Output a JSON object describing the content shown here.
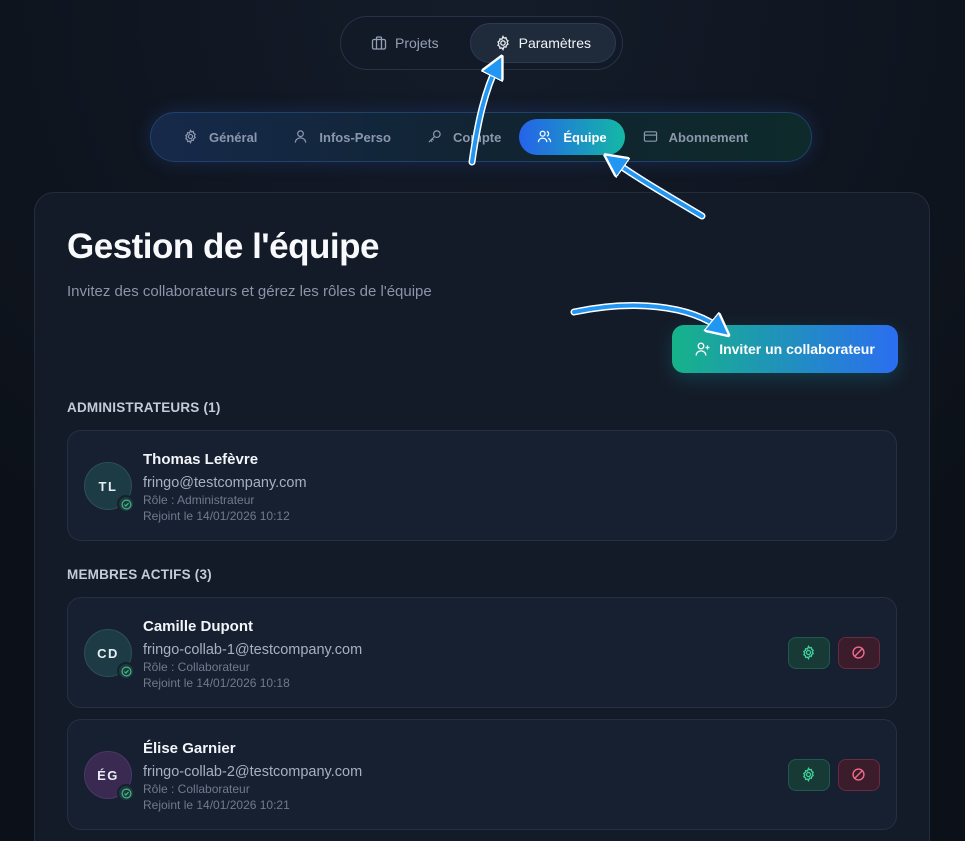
{
  "top_nav": {
    "tabs": [
      {
        "label": "Projets",
        "icon": "briefcase-icon",
        "active": false
      },
      {
        "label": "Paramètres",
        "icon": "gear-icon",
        "active": true
      }
    ]
  },
  "sub_nav": {
    "tabs": [
      {
        "label": "Général",
        "icon": "gear-icon",
        "active": false
      },
      {
        "label": "Infos-Perso",
        "icon": "user-icon",
        "active": false
      },
      {
        "label": "Compte",
        "icon": "key-icon",
        "active": false
      },
      {
        "label": "Équipe",
        "icon": "users-icon",
        "active": true
      },
      {
        "label": "Abonnement",
        "icon": "credit-card-icon",
        "active": false
      }
    ]
  },
  "page": {
    "title": "Gestion de l'équipe",
    "subtitle": "Invitez des collaborateurs et gérez les rôles de l'équipe",
    "invite_label": "Inviter un collaborateur"
  },
  "sections": {
    "admins_label": "ADMINISTRATEURS (1)",
    "members_label": "MEMBRES ACTIFS (3)"
  },
  "admins": [
    {
      "initials": "TL",
      "name": "Thomas Lefèvre",
      "email": "fringo@testcompany.com",
      "role": "Rôle : Administrateur",
      "joined": "Rejoint le 14/01/2026 10:12"
    }
  ],
  "members": [
    {
      "initials": "CD",
      "name": "Camille Dupont",
      "email": "fringo-collab-1@testcompany.com",
      "role": "Rôle : Collaborateur",
      "joined": "Rejoint le 14/01/2026 10:18"
    },
    {
      "initials": "ÉG",
      "name": "Élise Garnier",
      "email": "fringo-collab-2@testcompany.com",
      "role": "Rôle : Collaborateur",
      "joined": "Rejoint le 14/01/2026 10:21"
    }
  ],
  "colors": {
    "accent_blue": "#2563eb",
    "accent_teal": "#14b8a6",
    "annotation_arrow": "#2196f3"
  }
}
